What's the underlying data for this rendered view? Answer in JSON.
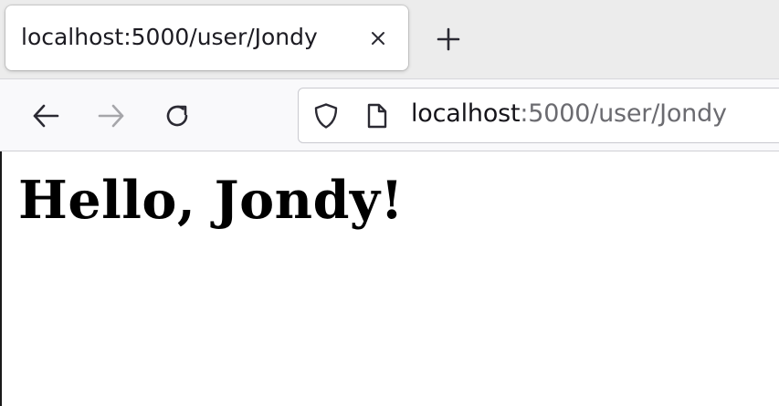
{
  "tab": {
    "title": "localhost:5000/user/Jondy"
  },
  "toolbar": {
    "url_host": "localhost",
    "url_rest": ":5000/user/Jondy"
  },
  "page": {
    "heading": "Hello, Jondy!"
  },
  "icons": {
    "tab_close": "close-icon",
    "new_tab": "plus-icon",
    "back": "arrow-left-icon",
    "forward": "arrow-right-icon",
    "reload": "reload-icon",
    "tracking_protection": "shield-icon",
    "page_info": "document-icon"
  },
  "colors": {
    "tabbar_bg": "#ececec",
    "toolbar_bg": "#f9f9fb",
    "url_rest_text": "#6b6b70",
    "forward_disabled": "#a6a6aa"
  }
}
